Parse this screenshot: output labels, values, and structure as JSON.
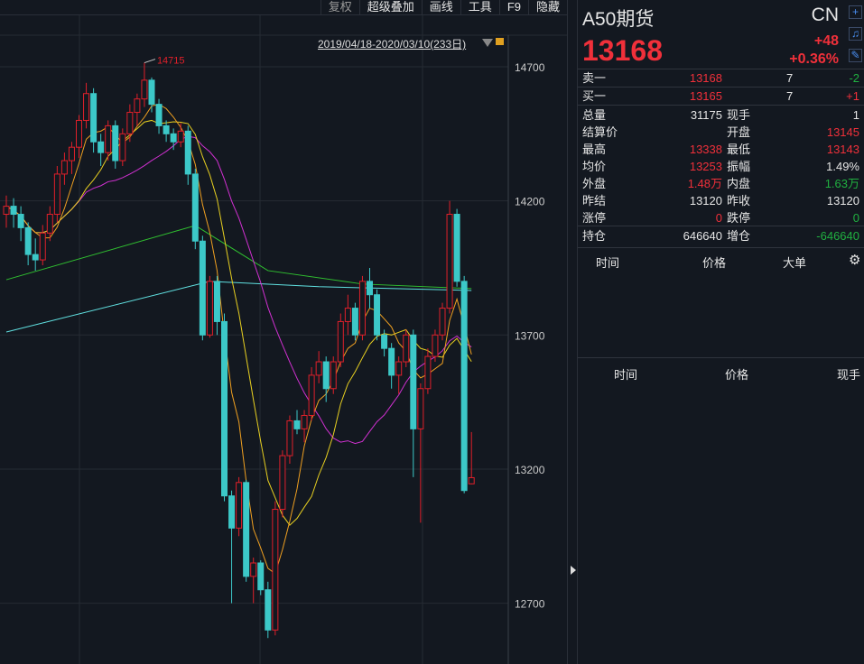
{
  "toolbar": {
    "items": [
      "复权",
      "超级叠加",
      "画线",
      "工具",
      "F9",
      "隐藏"
    ]
  },
  "range_label": "2019/04/18-2020/03/10(233日)",
  "high_marker": "14715",
  "panel": {
    "title": "A50期货",
    "market": "CN",
    "price": "13168",
    "change": "+48",
    "change_pct": "+0.36%",
    "sell1": {
      "label": "卖一",
      "price": "13168",
      "vol": "7",
      "delta": "-2"
    },
    "buy1": {
      "label": "买一",
      "price": "13165",
      "vol": "7",
      "delta": "+1"
    },
    "stats": [
      [
        "总量",
        "31175",
        "现手",
        "1"
      ],
      [
        "结算价",
        "",
        "开盘",
        "13145"
      ],
      [
        "最高",
        "13338",
        "最低",
        "13143"
      ],
      [
        "均价",
        "13253",
        "振幅",
        "1.49%"
      ],
      [
        "外盘",
        "1.48万",
        "内盘",
        "1.63万"
      ],
      [
        "昨结",
        "13120",
        "昨收",
        "13120"
      ],
      [
        "涨停",
        "0",
        "跌停",
        "0"
      ]
    ],
    "hold": {
      "label": "持仓",
      "value": "646640",
      "label2": "增仓",
      "value2": "-646640"
    },
    "tick_headers": [
      "时间",
      "价格",
      "大单"
    ],
    "trade_headers": [
      "时间",
      "价格",
      "现手"
    ]
  },
  "colors": {
    "up": "#e0202a",
    "down": "#3cc8c8",
    "ma5": "#e8e8e8",
    "ma10": "#e8d020",
    "ma20": "#d030d0",
    "ma60": "#30c030",
    "ma120": "#60e0e0"
  },
  "chart_data": {
    "type": "candlestick",
    "y_ticks": [
      14700,
      14200,
      13700,
      13200,
      12700
    ],
    "ylim": [
      12520,
      14760
    ],
    "ohlc": [
      [
        14150,
        14220,
        14100,
        14180
      ],
      [
        14180,
        14210,
        14100,
        14150
      ],
      [
        14150,
        14180,
        14050,
        14100
      ],
      [
        14100,
        14120,
        13960,
        14000
      ],
      [
        14000,
        14060,
        13940,
        13980
      ],
      [
        13980,
        14110,
        13960,
        14080
      ],
      [
        14080,
        14180,
        14050,
        14150
      ],
      [
        14150,
        14330,
        14120,
        14300
      ],
      [
        14300,
        14380,
        14260,
        14350
      ],
      [
        14350,
        14420,
        14300,
        14400
      ],
      [
        14400,
        14520,
        14360,
        14500
      ],
      [
        14500,
        14640,
        14470,
        14600
      ],
      [
        14600,
        14620,
        14380,
        14420
      ],
      [
        14420,
        14450,
        14330,
        14380
      ],
      [
        14380,
        14500,
        14350,
        14480
      ],
      [
        14480,
        14500,
        14320,
        14350
      ],
      [
        14350,
        14470,
        14330,
        14450
      ],
      [
        14450,
        14560,
        14420,
        14530
      ],
      [
        14530,
        14600,
        14480,
        14580
      ],
      [
        14580,
        14715,
        14550,
        14650
      ],
      [
        14650,
        14660,
        14530,
        14560
      ],
      [
        14560,
        14580,
        14450,
        14480
      ],
      [
        14480,
        14500,
        14420,
        14450
      ],
      [
        14450,
        14470,
        14390,
        14420
      ],
      [
        14420,
        14490,
        14400,
        14460
      ],
      [
        14460,
        14480,
        14260,
        14300
      ],
      [
        14300,
        14320,
        14020,
        14050
      ],
      [
        14050,
        14070,
        13680,
        13700
      ],
      [
        13700,
        13920,
        13690,
        13900
      ],
      [
        13900,
        13920,
        13700,
        13750
      ],
      [
        13750,
        13780,
        13080,
        13100
      ],
      [
        13100,
        13120,
        12700,
        12980
      ],
      [
        12980,
        13170,
        12950,
        13150
      ],
      [
        13150,
        13160,
        12780,
        12800
      ],
      [
        12800,
        12870,
        12700,
        12850
      ],
      [
        12850,
        12860,
        12730,
        12750
      ],
      [
        12750,
        12780,
        12570,
        12600
      ],
      [
        12600,
        13080,
        12580,
        13050
      ],
      [
        13050,
        13270,
        13020,
        13250
      ],
      [
        13250,
        13400,
        13220,
        13380
      ],
      [
        13380,
        13420,
        13330,
        13350
      ],
      [
        13350,
        13420,
        13300,
        13400
      ],
      [
        13400,
        13580,
        13380,
        13550
      ],
      [
        13550,
        13640,
        13520,
        13600
      ],
      [
        13600,
        13620,
        13450,
        13500
      ],
      [
        13500,
        13620,
        13480,
        13600
      ],
      [
        13600,
        13780,
        13580,
        13750
      ],
      [
        13750,
        13850,
        13700,
        13800
      ],
      [
        13800,
        13820,
        13680,
        13700
      ],
      [
        13700,
        13920,
        13680,
        13900
      ],
      [
        13900,
        13950,
        13800,
        13850
      ],
      [
        13850,
        13870,
        13680,
        13700
      ],
      [
        13700,
        13720,
        13620,
        13650
      ],
      [
        13650,
        13670,
        13500,
        13550
      ],
      [
        13550,
        13620,
        13480,
        13600
      ],
      [
        13600,
        13720,
        13580,
        13700
      ],
      [
        13700,
        13720,
        13170,
        13350
      ],
      [
        13350,
        13520,
        13000,
        13500
      ],
      [
        13500,
        13650,
        13480,
        13620
      ],
      [
        13620,
        13720,
        13600,
        13700
      ],
      [
        13700,
        13820,
        13680,
        13800
      ],
      [
        13800,
        14200,
        13780,
        14150
      ],
      [
        14150,
        14170,
        13880,
        13900
      ],
      [
        13900,
        13920,
        13110,
        13120
      ],
      [
        13145,
        13338,
        13143,
        13168
      ]
    ],
    "ma60": [
      [
        0,
        13906
      ],
      [
        26,
        14108
      ],
      [
        36,
        13940
      ],
      [
        49,
        13890
      ],
      [
        64,
        13873
      ]
    ],
    "ma120": [
      [
        0,
        13711
      ],
      [
        28,
        13900
      ],
      [
        43,
        13880
      ],
      [
        64,
        13866
      ]
    ]
  }
}
